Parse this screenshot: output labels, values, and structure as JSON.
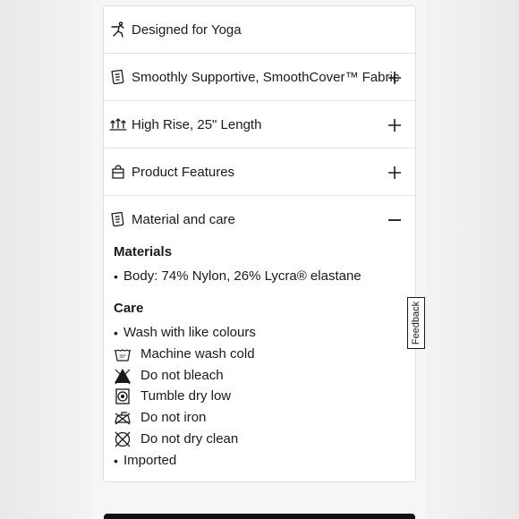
{
  "accordion": {
    "items": [
      {
        "label": "Designed for Yoga",
        "icon": "yoga-pose-icon"
      },
      {
        "label": "Smoothly Supportive, SmoothCover™ Fabric",
        "icon": "fabric-tag-icon",
        "toggle": "+"
      },
      {
        "label": "High Rise, 25\" Length",
        "icon": "rise-length-icon",
        "toggle": "+"
      },
      {
        "label": "Product Features",
        "icon": "features-bag-icon",
        "toggle": "+"
      },
      {
        "label": "Material and care",
        "icon": "fabric-tag-icon",
        "toggle": "−"
      }
    ]
  },
  "materials": {
    "title": "Materials",
    "items": [
      "Body: 74% Nylon, 26% Lycra® elastane"
    ]
  },
  "care": {
    "title": "Care",
    "items": [
      {
        "text": "Wash with like colours",
        "icon": "bullet"
      },
      {
        "text": "Machine wash cold",
        "icon": "machine-wash-cold-icon"
      },
      {
        "text": "Do not bleach",
        "icon": "do-not-bleach-icon"
      },
      {
        "text": "Tumble dry low",
        "icon": "tumble-dry-low-icon"
      },
      {
        "text": "Do not iron",
        "icon": "do-not-iron-icon"
      },
      {
        "text": "Do not dry clean",
        "icon": "do-not-dry-clean-icon"
      },
      {
        "text": "Imported",
        "icon": "bullet"
      }
    ]
  },
  "feedback": {
    "label": "Feedback"
  }
}
